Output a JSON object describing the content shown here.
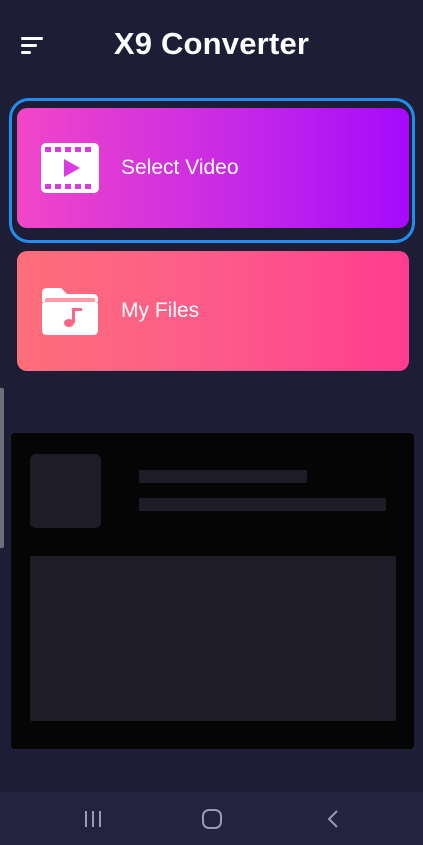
{
  "header": {
    "title": "X9 Converter",
    "menu_icon": "hamburger-menu-icon"
  },
  "actions": [
    {
      "label": "Select Video",
      "icon": "video-film-icon",
      "gradient": [
        "#f146c8",
        "#a50afb"
      ]
    },
    {
      "label": "My Files",
      "icon": "music-folder-icon",
      "gradient": [
        "#fd6f79",
        "#fe3c8e"
      ]
    }
  ],
  "colors": {
    "background": "#1e1d36",
    "focus_ring": "#1f8ef0",
    "nav_bar": "#23223f",
    "placeholder": "#050506",
    "skeleton": "#1d1c27"
  },
  "navigation": {
    "recent_icon": "recent-apps-icon",
    "home_icon": "home-icon",
    "back_icon": "back-chevron-icon"
  }
}
